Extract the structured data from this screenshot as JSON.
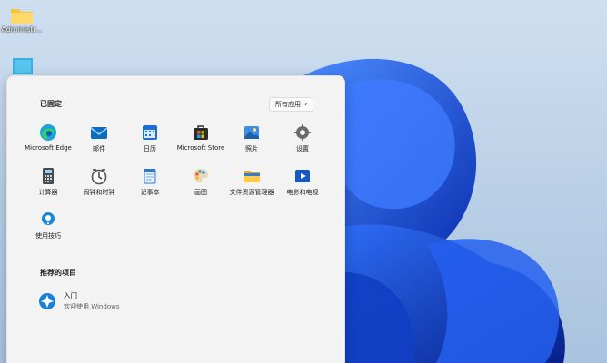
{
  "desktop": {
    "icons": [
      {
        "label": "Administr..."
      },
      {
        "label": ""
      }
    ],
    "wallpaper_accent": "#1a55e6"
  },
  "start_menu": {
    "pinned_title": "已固定",
    "all_apps_label": "所有应用",
    "pinned_apps": [
      {
        "name": "Microsoft Edge",
        "icon": "edge-icon"
      },
      {
        "name": "邮件",
        "icon": "mail-icon"
      },
      {
        "name": "日历",
        "icon": "calendar-icon"
      },
      {
        "name": "Microsoft Store",
        "icon": "store-icon"
      },
      {
        "name": "照片",
        "icon": "photos-icon"
      },
      {
        "name": "设置",
        "icon": "settings-icon"
      },
      {
        "name": "计算器",
        "icon": "calculator-icon"
      },
      {
        "name": "闹钟和时钟",
        "icon": "clock-icon"
      },
      {
        "name": "记事本",
        "icon": "notepad-icon"
      },
      {
        "name": "画图",
        "icon": "paint-icon"
      },
      {
        "name": "文件资源管理器",
        "icon": "folder-icon"
      },
      {
        "name": "电影和电视",
        "icon": "movies-icon"
      },
      {
        "name": "使用技巧",
        "icon": "tips-icon"
      }
    ],
    "recommended_title": "推荐的项目",
    "recommended": [
      {
        "title": "入门",
        "subtitle": "欢迎使用 Windows",
        "icon": "get-started-icon"
      }
    ]
  }
}
